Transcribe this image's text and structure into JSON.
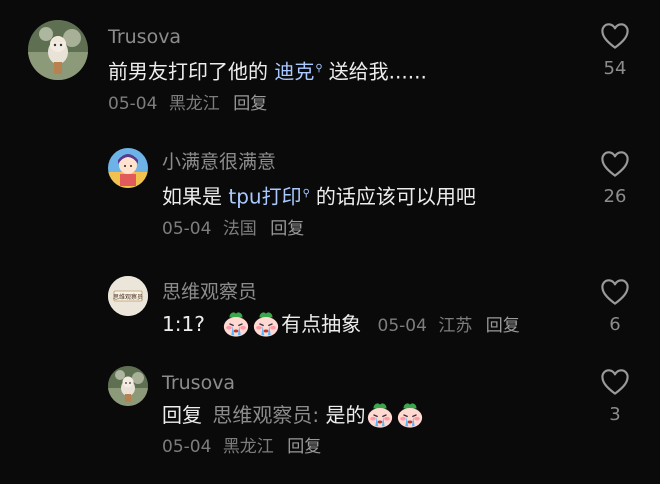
{
  "comments": [
    {
      "username": "Trusova",
      "text_before": "前男友打印了他的 ",
      "link": "迪克",
      "text_after": "送给我......",
      "date": "05-04",
      "location": "黑龙江",
      "reply_label": "回复",
      "likes": "54"
    },
    {
      "username": "小满意很满意",
      "text_before": "如果是 ",
      "link": "tpu打印",
      "text_after": "的话应该可以用吧",
      "date": "05-04",
      "location": "法国",
      "reply_label": "回复",
      "likes": "26"
    },
    {
      "username": "思维观察员",
      "text_before": "1:1?",
      "text_after": "有点抽象",
      "date": "05-04",
      "location": "江苏",
      "reply_label": "回复",
      "likes": "6",
      "avatar_text": "思维观察员"
    },
    {
      "username": "Trusova",
      "reply_prefix": "回复",
      "reply_target": "思维观察员:",
      "text_after": "是的",
      "date": "05-04",
      "location": "黑龙江",
      "reply_label": "回复",
      "likes": "3"
    }
  ],
  "icons": {
    "like": "heart-outline-icon",
    "search_mark": "search-icon",
    "emoji": "crying-emoji"
  },
  "colors": {
    "background": "#0a0a0a",
    "link": "#a9c9ff",
    "muted": "#8c8c8c"
  }
}
